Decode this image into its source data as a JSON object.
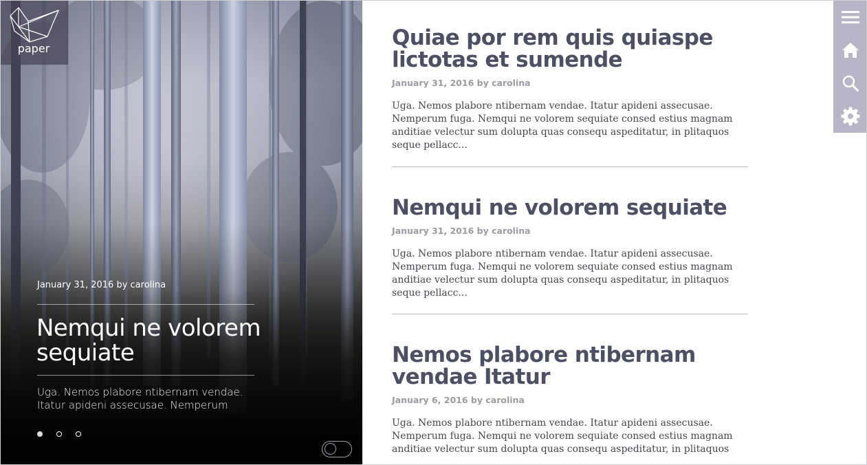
{
  "logo": {
    "text": "paper"
  },
  "hero": {
    "meta": "January 31, 2016 by carolina",
    "title": "Nemqui ne volorem sequiate",
    "excerpt": "Uga. Nemos plabore ntibernam vendae. Itatur apideni assecusae. Nemperum",
    "slides": [
      {
        "active": true
      },
      {
        "active": false
      },
      {
        "active": false
      }
    ]
  },
  "posts": [
    {
      "title": "Quiae por rem quis quiaspe lictotas et sumende",
      "meta": "January 31, 2016 by carolina",
      "excerpt": "Uga. Nemos plabore ntibernam vendae. Itatur apideni assecusae. Nemperum fuga. Nemqui ne volorem sequiate consed estius magnam anditiae velectur sum dolupta quas consequ aspeditatur, in plitaquos seque pellacc..."
    },
    {
      "title": "Nemqui ne volorem sequiate",
      "meta": "January 31, 2016 by carolina",
      "excerpt": "Uga. Nemos plabore ntibernam vendae. Itatur apideni assecusae. Nemperum fuga. Nemqui ne volorem sequiate consed estius magnam anditiae velectur sum dolupta quas consequ aspeditatur, in plitaquos seque pellacc..."
    },
    {
      "title": "Nemos plabore ntibernam vendae Itatur",
      "meta": "January 6, 2016 by carolina",
      "excerpt": "Uga. Nemos plabore ntibernam vendae. Itatur apideni assecusae. Nemperum fuga. Nemqui ne volorem sequiate consed estius magnam anditiae velectur sum dolupta quas consequ aspeditatur, in plitaquos"
    }
  ],
  "nav": {
    "icons": [
      "menu-icon",
      "home-icon",
      "search-icon",
      "gear-icon"
    ]
  },
  "colors": {
    "title": "#4e4f62",
    "meta": "#9b9ba4",
    "nav_bg": "#bab5c6",
    "logo_bg": "#464458"
  }
}
